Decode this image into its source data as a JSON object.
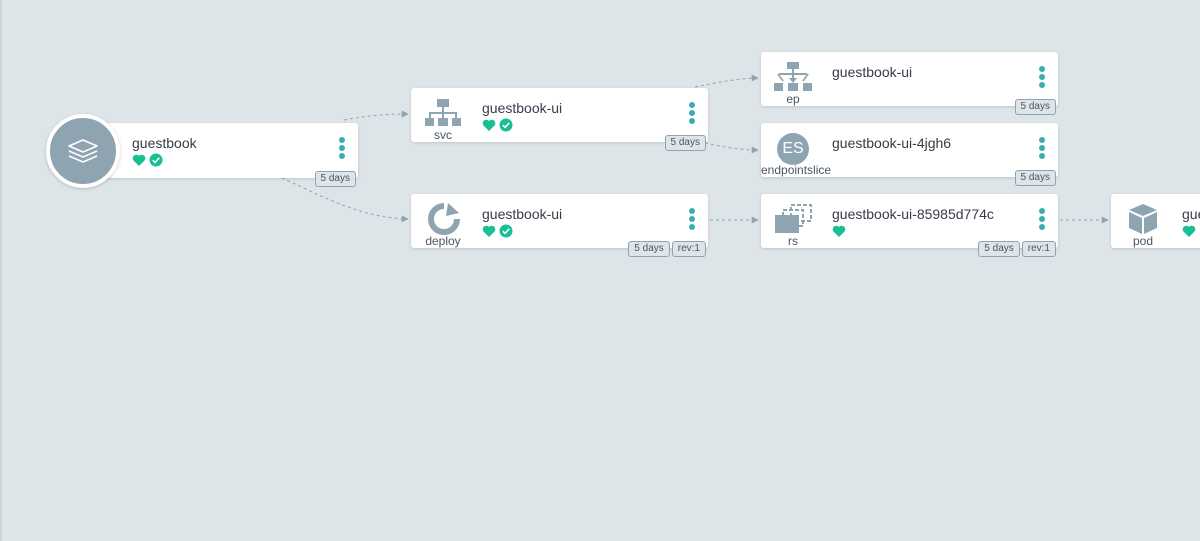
{
  "colors": {
    "background": "#dee5e8",
    "accent_teal": "#3cadb5",
    "healthy_green": "#18be94",
    "icon_gray": "#8fa4b1"
  },
  "nodes": {
    "app": {
      "title": "guestbook",
      "icon": "layers-icon",
      "status": [
        "healthy-heart-icon",
        "synced-check-icon"
      ],
      "tags": [
        "5 days"
      ]
    },
    "svc": {
      "title": "guestbook-ui",
      "kind": "svc",
      "icon": "service-icon",
      "status": [
        "healthy-heart-icon",
        "synced-check-icon"
      ],
      "tags": [
        "5 days"
      ]
    },
    "deploy": {
      "title": "guestbook-ui",
      "kind": "deploy",
      "icon": "deploy-icon",
      "status": [
        "healthy-heart-icon",
        "synced-check-icon"
      ],
      "tags": [
        "5 days",
        "rev:1"
      ]
    },
    "ep": {
      "title": "guestbook-ui",
      "kind": "ep",
      "icon": "endpoints-icon",
      "tags": [
        "5 days"
      ]
    },
    "endpointslice": {
      "title": "guestbook-ui-4jgh6",
      "kind": "endpointslice",
      "icon_text": "ES",
      "tags": [
        "5 days"
      ]
    },
    "rs": {
      "title": "guestbook-ui-85985d774c",
      "kind": "rs",
      "icon": "replicaset-icon",
      "status": [
        "healthy-heart-icon"
      ],
      "tags": [
        "5 days",
        "rev:1"
      ]
    },
    "pod": {
      "title": "gue",
      "kind": "pod",
      "icon": "pod-cube-icon",
      "status": [
        "healthy-heart-icon"
      ]
    }
  }
}
